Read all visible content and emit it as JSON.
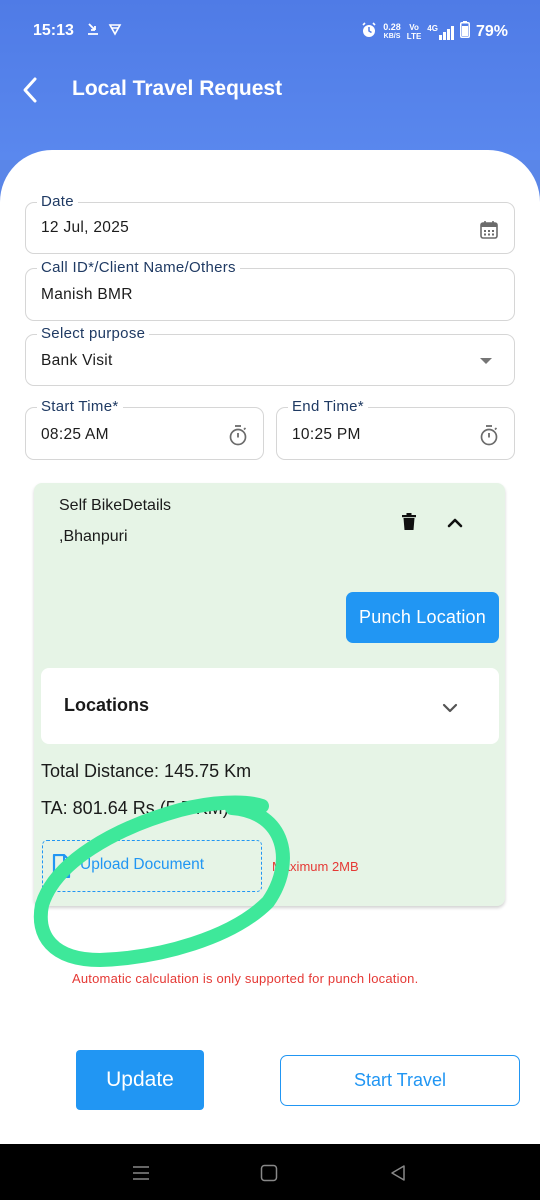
{
  "status_bar": {
    "time": "15:13",
    "net_speed_value": "0.28",
    "net_speed_unit": "KB/S",
    "network_type": "4G",
    "battery": "79%"
  },
  "header": {
    "title": "Local Travel Request",
    "back_icon": "chevron-left-icon"
  },
  "form": {
    "date": {
      "label": "Date",
      "value": "12 Jul, 2025",
      "icon": "calendar-icon"
    },
    "call_id": {
      "label": "Call ID*/Client Name/Others",
      "value": "Manish BMR"
    },
    "purpose": {
      "label": "Select purpose",
      "value": "Bank Visit",
      "icon": "dropdown-arrow-icon"
    },
    "start_time": {
      "label": "Start Time*",
      "value": "08:25 AM",
      "icon": "timer-icon"
    },
    "end_time": {
      "label": "End Time*",
      "value": "10:25 PM",
      "icon": "timer-icon"
    }
  },
  "travel_card": {
    "title": "Self BikeDetails",
    "subtitle": ",Bhanpuri",
    "delete_icon": "trash-icon",
    "collapse_icon": "chevron-up-icon",
    "punch_button": "Punch Location",
    "locations": {
      "label": "Locations",
      "icon": "chevron-down-icon"
    },
    "total_distance": "Total Distance: 145.75 Km",
    "ta": "TA: 801.64 Rs (5.5/KM)",
    "upload": {
      "label": "Upload Document",
      "icon": "document-icon"
    },
    "max_size": "Maximum 2MB"
  },
  "note": "Automatic calculation is only supported for punch location.",
  "buttons": {
    "update": "Update",
    "start_travel": "Start Travel"
  },
  "colors": {
    "header": "#4f7be6",
    "primary": "#2196f3",
    "card_bg": "#e6f4e6",
    "error": "#e53935",
    "annotation": "#3ee89a"
  },
  "nav_bar": {
    "menu_icon": "menu-icon",
    "home_icon": "square-icon",
    "back_icon": "triangle-back-icon"
  }
}
